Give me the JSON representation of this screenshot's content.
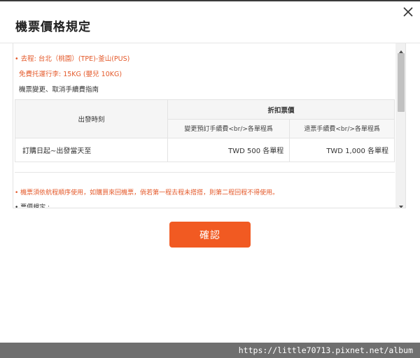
{
  "dialog": {
    "title": "機票價格規定",
    "close_icon": "close-icon"
  },
  "info": {
    "route": "• 去程: 台北（桃園）(TPE)-釜山(PUS)",
    "baggage": "免費托運行李: 15KG (嬰兒 10KG)",
    "change_guide": "機票變更、取消手續費指南"
  },
  "fare_table": {
    "departure_header": "出發時刻",
    "discount_header": "折扣票價",
    "change_fee_header": "變更預訂手續費<br/>各單程爲",
    "refund_fee_header": "退票手續費<br/>各單程爲",
    "rows": [
      {
        "period": "訂購日起~出發當天至",
        "change_fee": "TWD 500 各單程",
        "refund_fee": "TWD 1,000 各單程"
      }
    ]
  },
  "notes": {
    "warning": "• 機票須依航程順序使用，如購買來回機票，倘若第一程去程未搭搭，則第二程回程不得使用。",
    "rules_heading": "• 票價規定 :"
  },
  "buttons": {
    "confirm_label": "確認"
  },
  "footer": {
    "url": "https://little70713.pixnet.net/album"
  },
  "colors": {
    "accent": "#f15a22",
    "warning_text": "#e4592a",
    "footer_bg": "#6f6f6f"
  }
}
